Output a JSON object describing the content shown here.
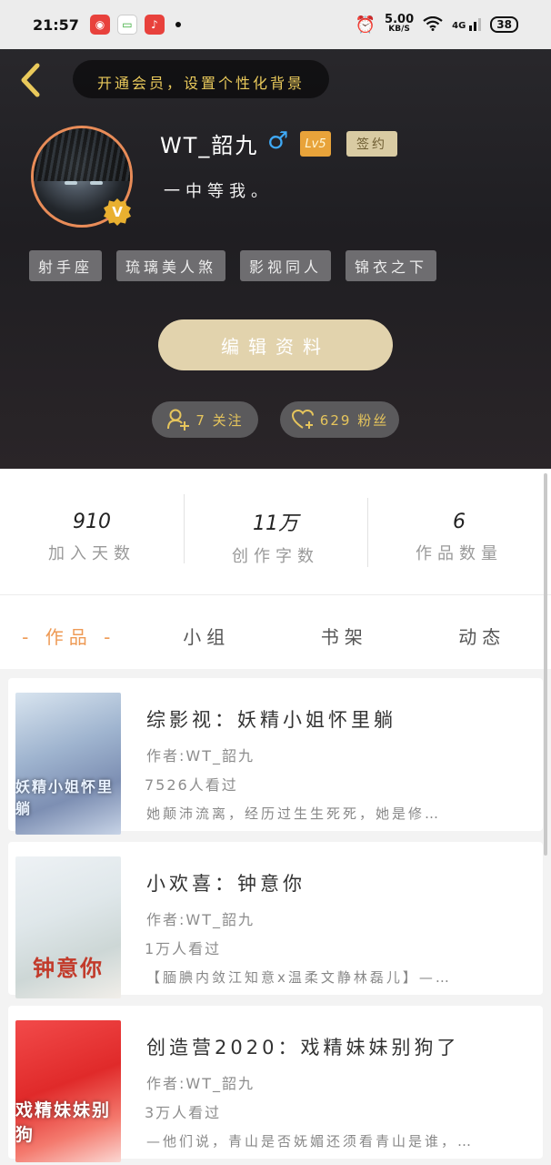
{
  "status_bar": {
    "time": "21:57",
    "speed_value": "5.00",
    "speed_unit": "KB/S",
    "network": "4G",
    "battery": "38"
  },
  "header": {
    "vip_banner": "开通会员，设置个性化背景",
    "username": "WT_韶九",
    "gender_symbol": "♂",
    "level": "Lv5",
    "signed_label": "签约",
    "bio": "一中等我。",
    "avatar_badge": "V",
    "tags": [
      "射手座",
      "琉璃美人煞",
      "影视同人",
      "锦衣之下"
    ],
    "edit_button": "编辑资料",
    "follow_count": "7 关注",
    "fans_count": "629 粉丝"
  },
  "stats": [
    {
      "value": "910",
      "label": "加入天数"
    },
    {
      "value": "11万",
      "label": "创作字数"
    },
    {
      "value": "6",
      "label": "作品数量"
    }
  ],
  "tabs": [
    {
      "label": "作品",
      "active": true
    },
    {
      "label": "小组",
      "active": false
    },
    {
      "label": "书架",
      "active": false
    },
    {
      "label": "动态",
      "active": false
    }
  ],
  "works": [
    {
      "title": "综影视：妖精小姐怀里躺",
      "author": "作者:WT_韶九",
      "views": "7526人看过",
      "desc": "她颠沛流离，经历过生生死死，她是修…",
      "cover_text": "妖精小姐怀里躺"
    },
    {
      "title": "小欢喜：钟意你",
      "author": "作者:WT_韶九",
      "views": "1万人看过",
      "desc": "【腼腆内敛江知意x温柔文静林磊儿】—…",
      "cover_text": "钟意你"
    },
    {
      "title": "创造营2020：戏精妹妹别狗了",
      "author": "作者:WT_韶九",
      "views": "3万人看过",
      "desc": "—他们说，青山是否妩媚还须看青山是谁，…",
      "cover_text": "戏精妹妹别狗"
    }
  ]
}
